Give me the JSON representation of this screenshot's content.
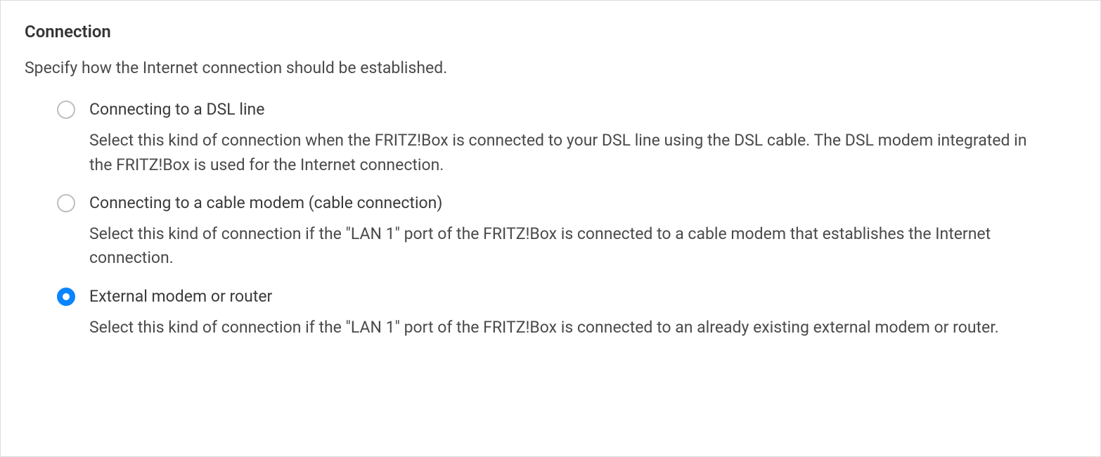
{
  "connection": {
    "title": "Connection",
    "description": "Specify how the Internet connection should be established.",
    "selected": 2,
    "options": [
      {
        "label": "Connecting to a DSL line",
        "description": "Select this kind of connection when the FRITZ!Box is connected to your DSL line using the DSL cable. The DSL modem integrated in the FRITZ!Box is used for the Internet connection."
      },
      {
        "label": "Connecting to a cable modem (cable connection)",
        "description": "Select this kind of connection if the \"LAN 1\" port of the FRITZ!Box is connected to a cable modem that establishes the Internet connection."
      },
      {
        "label": "External modem or router",
        "description": "Select this kind of connection if the \"LAN 1\" port of the FRITZ!Box is connected to an already existing external modem or router."
      }
    ]
  }
}
